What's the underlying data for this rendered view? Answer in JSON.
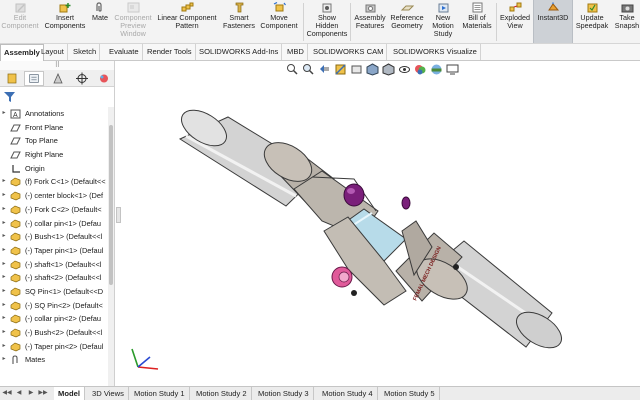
{
  "ribbon": {
    "edit_component": "Edit\nComponent",
    "insert_components": "Insert\nComponents",
    "mate": "Mate",
    "component_preview": "Component\nPreview\nWindow",
    "linear_pattern": "Linear Component\nPattern",
    "smart_fasteners": "Smart\nFasteners",
    "move_component": "Move\nComponent",
    "show_hidden": "Show\nHidden\nComponents",
    "assembly_features": "Assembly\nFeatures",
    "reference_geometry": "Reference\nGeometry",
    "new_motion_study": "New\nMotion\nStudy",
    "bill_of_materials": "Bill of\nMaterials",
    "exploded_view": "Exploded\nView",
    "instant3d": "Instant3D",
    "update_speedpak": "Update\nSpeedpak",
    "take_snapshot": "Take\nSnapsh"
  },
  "tabs": [
    "Assembly",
    "Layout",
    "Sketch",
    "Evaluate",
    "Render Tools",
    "SOLIDWORKS Add-Ins",
    "MBD",
    "SOLIDWORKS CAM",
    "SOLIDWORKS Visualize"
  ],
  "feature_tree": [
    {
      "label": "Annotations",
      "icon": "annotations-icon",
      "expand": true
    },
    {
      "label": "Front Plane",
      "icon": "plane-icon",
      "expand": false
    },
    {
      "label": "Top Plane",
      "icon": "plane-icon",
      "expand": false
    },
    {
      "label": "Right Plane",
      "icon": "plane-icon",
      "expand": false
    },
    {
      "label": "Origin",
      "icon": "origin-icon",
      "expand": false
    },
    {
      "label": "(f) Fork C<1> (Default<<",
      "icon": "part-icon",
      "expand": true
    },
    {
      "label": "(-) center block<1> (Def",
      "icon": "part-icon",
      "expand": true
    },
    {
      "label": "(-) Fork C<2> (Default<",
      "icon": "part-icon",
      "expand": true
    },
    {
      "label": "(-) collar pin<1> (Defau",
      "icon": "part-icon",
      "expand": true
    },
    {
      "label": "(-) Bush<1> (Default<<l",
      "icon": "part-icon",
      "expand": true
    },
    {
      "label": "(-) Taper pin<1> (Defaul",
      "icon": "part-icon",
      "expand": true
    },
    {
      "label": "(-) shaft<1> (Default<<l",
      "icon": "part-icon",
      "expand": true
    },
    {
      "label": "(-) shaft<2> (Default<<l",
      "icon": "part-icon",
      "expand": true
    },
    {
      "label": "SQ Pin<1> (Default<<D",
      "icon": "part-icon",
      "expand": true
    },
    {
      "label": "(-) SQ Pin<2> (Default<",
      "icon": "part-icon",
      "expand": true
    },
    {
      "label": "(-) collar pin<2> (Defau",
      "icon": "part-icon",
      "expand": true
    },
    {
      "label": "(-) Bush<2> (Default<<l",
      "icon": "part-icon",
      "expand": true
    },
    {
      "label": "(-) Taper pin<2> (Defaul",
      "icon": "part-icon",
      "expand": true
    },
    {
      "label": "Mates",
      "icon": "mates-icon",
      "expand": true
    }
  ],
  "fm_grip": "⠿",
  "model": {
    "engraving": "FEMAL MECH DESIGN",
    "colors": {
      "shaft": "#c9c9c9",
      "fork": "#bcb6ad",
      "pin_purple": "#7a1f7a",
      "block_blue": "#b7dbe9",
      "pin_pink": "#e05a9a"
    }
  },
  "bottom_tabs": [
    "Model",
    "3D Views",
    "Motion Study 1",
    "Motion Study 2",
    "Motion Study 3",
    "Motion Study 4",
    "Motion Study 5"
  ],
  "nav_buttons": [
    "◀◀",
    "◀",
    "▶",
    "▶▶"
  ]
}
